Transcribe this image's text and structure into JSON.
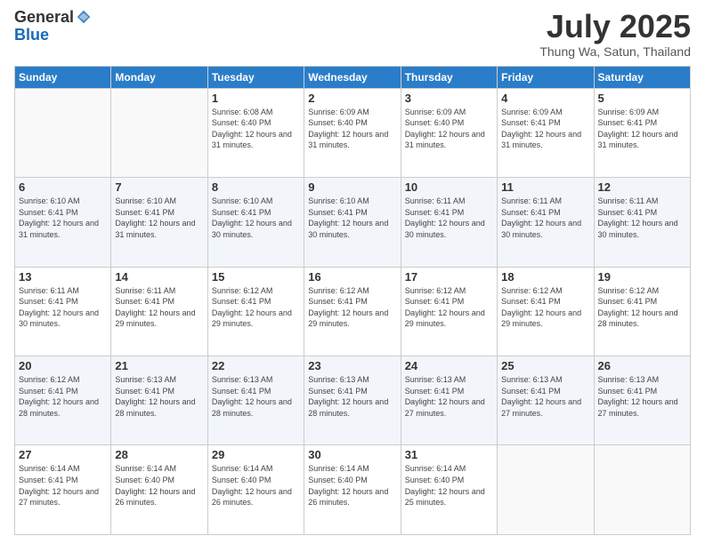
{
  "logo": {
    "general": "General",
    "blue": "Blue"
  },
  "header": {
    "month": "July 2025",
    "location": "Thung Wa, Satun, Thailand"
  },
  "weekdays": [
    "Sunday",
    "Monday",
    "Tuesday",
    "Wednesday",
    "Thursday",
    "Friday",
    "Saturday"
  ],
  "weeks": [
    [
      {
        "day": "",
        "info": ""
      },
      {
        "day": "",
        "info": ""
      },
      {
        "day": "1",
        "info": "Sunrise: 6:08 AM\nSunset: 6:40 PM\nDaylight: 12 hours and 31 minutes."
      },
      {
        "day": "2",
        "info": "Sunrise: 6:09 AM\nSunset: 6:40 PM\nDaylight: 12 hours and 31 minutes."
      },
      {
        "day": "3",
        "info": "Sunrise: 6:09 AM\nSunset: 6:40 PM\nDaylight: 12 hours and 31 minutes."
      },
      {
        "day": "4",
        "info": "Sunrise: 6:09 AM\nSunset: 6:41 PM\nDaylight: 12 hours and 31 minutes."
      },
      {
        "day": "5",
        "info": "Sunrise: 6:09 AM\nSunset: 6:41 PM\nDaylight: 12 hours and 31 minutes."
      }
    ],
    [
      {
        "day": "6",
        "info": "Sunrise: 6:10 AM\nSunset: 6:41 PM\nDaylight: 12 hours and 31 minutes."
      },
      {
        "day": "7",
        "info": "Sunrise: 6:10 AM\nSunset: 6:41 PM\nDaylight: 12 hours and 31 minutes."
      },
      {
        "day": "8",
        "info": "Sunrise: 6:10 AM\nSunset: 6:41 PM\nDaylight: 12 hours and 30 minutes."
      },
      {
        "day": "9",
        "info": "Sunrise: 6:10 AM\nSunset: 6:41 PM\nDaylight: 12 hours and 30 minutes."
      },
      {
        "day": "10",
        "info": "Sunrise: 6:11 AM\nSunset: 6:41 PM\nDaylight: 12 hours and 30 minutes."
      },
      {
        "day": "11",
        "info": "Sunrise: 6:11 AM\nSunset: 6:41 PM\nDaylight: 12 hours and 30 minutes."
      },
      {
        "day": "12",
        "info": "Sunrise: 6:11 AM\nSunset: 6:41 PM\nDaylight: 12 hours and 30 minutes."
      }
    ],
    [
      {
        "day": "13",
        "info": "Sunrise: 6:11 AM\nSunset: 6:41 PM\nDaylight: 12 hours and 30 minutes."
      },
      {
        "day": "14",
        "info": "Sunrise: 6:11 AM\nSunset: 6:41 PM\nDaylight: 12 hours and 29 minutes."
      },
      {
        "day": "15",
        "info": "Sunrise: 6:12 AM\nSunset: 6:41 PM\nDaylight: 12 hours and 29 minutes."
      },
      {
        "day": "16",
        "info": "Sunrise: 6:12 AM\nSunset: 6:41 PM\nDaylight: 12 hours and 29 minutes."
      },
      {
        "day": "17",
        "info": "Sunrise: 6:12 AM\nSunset: 6:41 PM\nDaylight: 12 hours and 29 minutes."
      },
      {
        "day": "18",
        "info": "Sunrise: 6:12 AM\nSunset: 6:41 PM\nDaylight: 12 hours and 29 minutes."
      },
      {
        "day": "19",
        "info": "Sunrise: 6:12 AM\nSunset: 6:41 PM\nDaylight: 12 hours and 28 minutes."
      }
    ],
    [
      {
        "day": "20",
        "info": "Sunrise: 6:12 AM\nSunset: 6:41 PM\nDaylight: 12 hours and 28 minutes."
      },
      {
        "day": "21",
        "info": "Sunrise: 6:13 AM\nSunset: 6:41 PM\nDaylight: 12 hours and 28 minutes."
      },
      {
        "day": "22",
        "info": "Sunrise: 6:13 AM\nSunset: 6:41 PM\nDaylight: 12 hours and 28 minutes."
      },
      {
        "day": "23",
        "info": "Sunrise: 6:13 AM\nSunset: 6:41 PM\nDaylight: 12 hours and 28 minutes."
      },
      {
        "day": "24",
        "info": "Sunrise: 6:13 AM\nSunset: 6:41 PM\nDaylight: 12 hours and 27 minutes."
      },
      {
        "day": "25",
        "info": "Sunrise: 6:13 AM\nSunset: 6:41 PM\nDaylight: 12 hours and 27 minutes."
      },
      {
        "day": "26",
        "info": "Sunrise: 6:13 AM\nSunset: 6:41 PM\nDaylight: 12 hours and 27 minutes."
      }
    ],
    [
      {
        "day": "27",
        "info": "Sunrise: 6:14 AM\nSunset: 6:41 PM\nDaylight: 12 hours and 27 minutes."
      },
      {
        "day": "28",
        "info": "Sunrise: 6:14 AM\nSunset: 6:40 PM\nDaylight: 12 hours and 26 minutes."
      },
      {
        "day": "29",
        "info": "Sunrise: 6:14 AM\nSunset: 6:40 PM\nDaylight: 12 hours and 26 minutes."
      },
      {
        "day": "30",
        "info": "Sunrise: 6:14 AM\nSunset: 6:40 PM\nDaylight: 12 hours and 26 minutes."
      },
      {
        "day": "31",
        "info": "Sunrise: 6:14 AM\nSunset: 6:40 PM\nDaylight: 12 hours and 25 minutes."
      },
      {
        "day": "",
        "info": ""
      },
      {
        "day": "",
        "info": ""
      }
    ]
  ]
}
